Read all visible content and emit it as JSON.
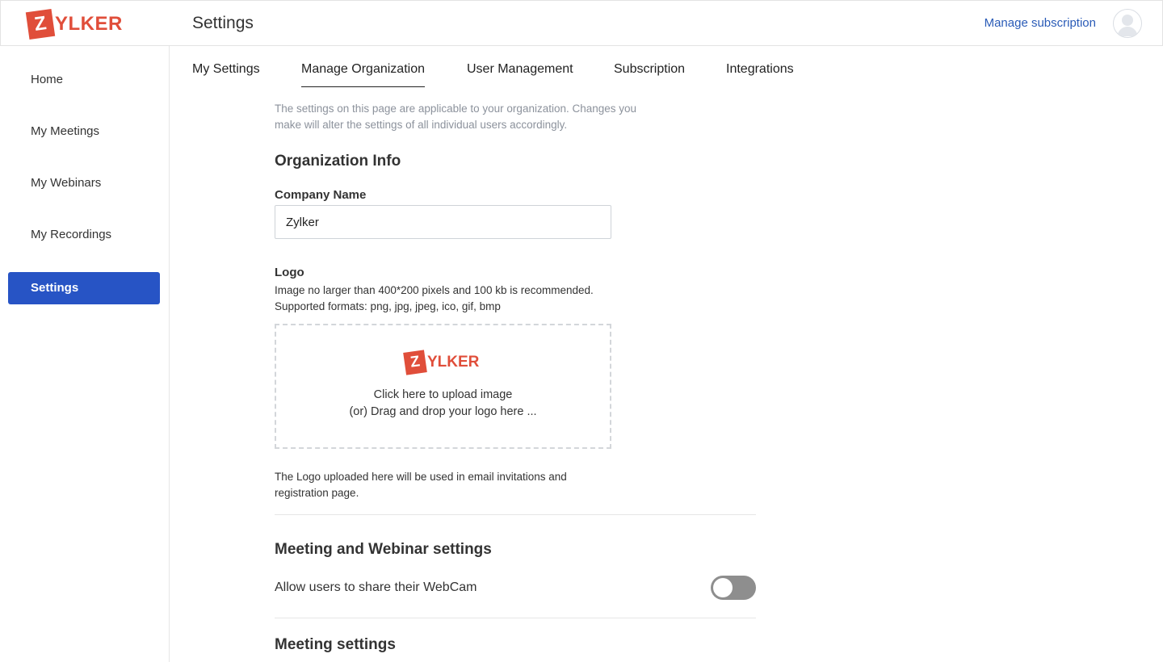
{
  "header": {
    "brand": {
      "z": "Z",
      "word": "YLKER"
    },
    "title": "Settings",
    "manage_subscription": "Manage subscription"
  },
  "sidebar": {
    "items": [
      {
        "label": "Home"
      },
      {
        "label": "My Meetings"
      },
      {
        "label": "My Webinars"
      },
      {
        "label": "My Recordings"
      },
      {
        "label": "Settings",
        "active": true
      }
    ]
  },
  "tabs": [
    {
      "label": "My Settings"
    },
    {
      "label": "Manage Organization",
      "active": true
    },
    {
      "label": "User Management"
    },
    {
      "label": "Subscription"
    },
    {
      "label": "Integrations"
    }
  ],
  "main": {
    "note": "The settings on this page are applicable to your organization. Changes you make will alter the settings of all individual users accordingly.",
    "org_info_heading": "Organization Info",
    "company_name_label": "Company Name",
    "company_name_value": "Zylker",
    "logo_label": "Logo",
    "logo_hint1": "Image no larger than 400*200 pixels and 100 kb is recommended.",
    "logo_hint2": "Supported formats: png, jpg, jpeg, ico, gif, bmp",
    "upload": {
      "logo_z": "Z",
      "logo_word": "YLKER",
      "line1": "Click here to upload image",
      "line2": "(or) Drag and drop your logo here ..."
    },
    "logo_usage_note": "The Logo uploaded here will be used in email invitations and registration page.",
    "meeting_webinar_heading": "Meeting and Webinar settings",
    "webcam_label": "Allow users to share their WebCam",
    "webcam_enabled": false,
    "meeting_heading": "Meeting settings"
  },
  "colors": {
    "accent": "#2754c5",
    "brand": "#e04e3a",
    "link": "#2a5bb7",
    "toggle_off": "#8e8e8e"
  }
}
